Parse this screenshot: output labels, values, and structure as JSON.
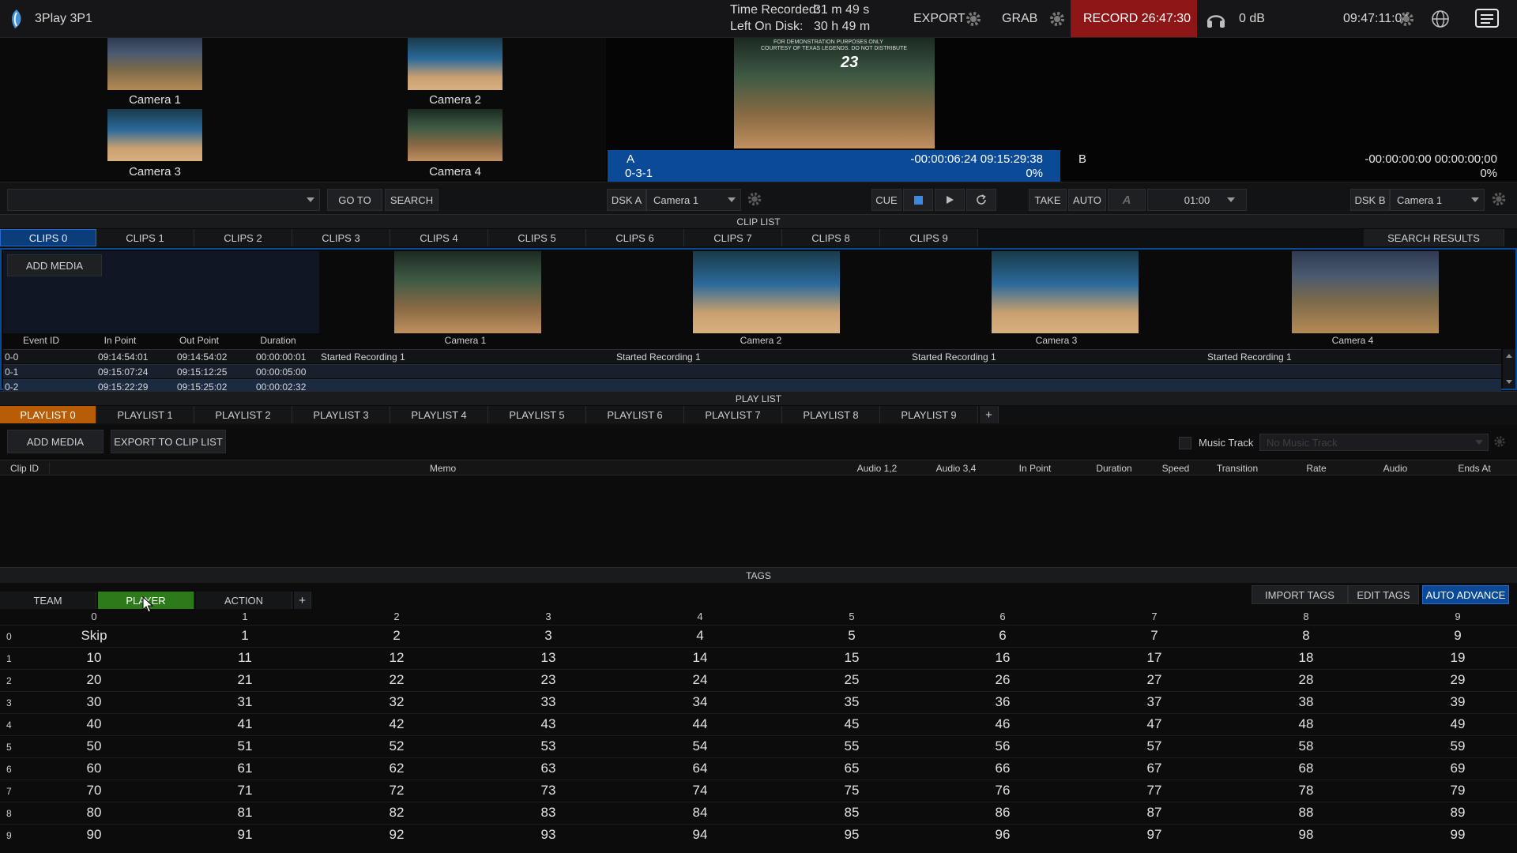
{
  "app": {
    "title": "3Play 3P1"
  },
  "status": {
    "time_recorded_label": "Time Recorded:",
    "time_recorded_value": "31 m 49 s",
    "left_on_disk_label": "Left On Disk:",
    "left_on_disk_value": "30 h 49 m",
    "export_label": "EXPORT",
    "grab_label": "GRAB",
    "record_label": "RECORD 26:47:30",
    "audio_level": "0 dB",
    "clock": "09:47:11:04"
  },
  "cameras": [
    {
      "label": "Camera 1"
    },
    {
      "label": "Camera 2"
    },
    {
      "label": "Camera 3"
    },
    {
      "label": "Camera 4"
    }
  ],
  "program": {
    "overlay_line1": "FOR DEMONSTRATION PURPOSES ONLY",
    "overlay_line2": "COURTESY OF TEXAS LEGENDS. DO NOT DISTRIBUTE",
    "jersey": "23",
    "a_channel": "A",
    "a_clip": "0-3-1",
    "a_time": "-00:00:06:24 09:15:29:38",
    "a_pct": "0%",
    "b_channel": "B",
    "b_time": "-00:00:00:00 00:00:00;00",
    "b_pct": "0%"
  },
  "controls": {
    "goto_label": "GO TO",
    "search_label": "SEARCH",
    "dska_label": "DSK A",
    "dska_source": "Camera 1",
    "cue_label": "CUE",
    "take_label": "TAKE",
    "auto_label": "AUTO",
    "duration": "01:00",
    "dskb_label": "DSK B",
    "dskb_source": "Camera 1"
  },
  "clip_list": {
    "header": "CLIP LIST",
    "tabs": [
      "CLIPS 0",
      "CLIPS 1",
      "CLIPS 2",
      "CLIPS 3",
      "CLIPS 4",
      "CLIPS 5",
      "CLIPS 6",
      "CLIPS 7",
      "CLIPS 8",
      "CLIPS 9"
    ],
    "search_results_label": "SEARCH RESULTS",
    "add_media_label": "ADD MEDIA",
    "columns": {
      "event_id": "Event ID",
      "in_point": "In Point",
      "out_point": "Out Point",
      "duration": "Duration"
    },
    "camera_columns": [
      "Camera 1",
      "Camera 2",
      "Camera 3",
      "Camera 4"
    ],
    "rows": [
      {
        "id": "0-0",
        "in": "09:14:54:01",
        "out": "09:14:54:02",
        "dur": "00:00:00:01",
        "c1": "Started Recording 1",
        "c2": "Started Recording 1",
        "c3": "Started Recording 1",
        "c4": "Started Recording 1"
      },
      {
        "id": "0-1",
        "in": "09:15:07:24",
        "out": "09:15:12:25",
        "dur": "00:00:05:00",
        "c1": "",
        "c2": "",
        "c3": "",
        "c4": ""
      },
      {
        "id": "0-2",
        "in": "09:15:22:29",
        "out": "09:15:25:02",
        "dur": "00:00:02:32",
        "c1": "",
        "c2": "",
        "c3": "",
        "c4": ""
      }
    ]
  },
  "play_list": {
    "header": "PLAY LIST",
    "tabs": [
      "PLAYLIST 0",
      "PLAYLIST 1",
      "PLAYLIST 2",
      "PLAYLIST 3",
      "PLAYLIST 4",
      "PLAYLIST 5",
      "PLAYLIST 6",
      "PLAYLIST 7",
      "PLAYLIST 8",
      "PLAYLIST 9"
    ],
    "add_tab": "+",
    "add_media_label": "ADD MEDIA",
    "export_label": "EXPORT TO CLIP LIST",
    "music_track_label": "Music Track",
    "music_track_placeholder": "No Music Track",
    "columns": [
      "Clip ID",
      "Memo",
      "Audio 1,2",
      "Audio 3,4",
      "In Point",
      "Duration",
      "Speed",
      "Transition",
      "Rate",
      "Audio",
      "Ends At"
    ]
  },
  "tags": {
    "header": "TAGS",
    "tabs": [
      "TEAM",
      "PLAYER",
      "ACTION"
    ],
    "add_tab": "+",
    "import_label": "IMPORT TAGS",
    "edit_label": "EDIT TAGS",
    "auto_advance_label": "AUTO ADVANCE",
    "col_headers": [
      "0",
      "1",
      "2",
      "3",
      "4",
      "5",
      "6",
      "7",
      "8",
      "9"
    ],
    "row_headers": [
      "0",
      "1",
      "2",
      "3",
      "4",
      "5",
      "6",
      "7",
      "8",
      "9"
    ],
    "grid": [
      [
        "Skip",
        "1",
        "2",
        "3",
        "4",
        "5",
        "6",
        "7",
        "8",
        "9"
      ],
      [
        "10",
        "11",
        "12",
        "13",
        "14",
        "15",
        "16",
        "17",
        "18",
        "19"
      ],
      [
        "20",
        "21",
        "22",
        "23",
        "24",
        "25",
        "26",
        "27",
        "28",
        "29"
      ],
      [
        "30",
        "31",
        "32",
        "33",
        "34",
        "35",
        "36",
        "37",
        "38",
        "39"
      ],
      [
        "40",
        "41",
        "42",
        "43",
        "44",
        "45",
        "46",
        "47",
        "48",
        "49"
      ],
      [
        "50",
        "51",
        "52",
        "53",
        "54",
        "55",
        "56",
        "57",
        "58",
        "59"
      ],
      [
        "60",
        "61",
        "62",
        "63",
        "64",
        "65",
        "66",
        "67",
        "68",
        "69"
      ],
      [
        "70",
        "71",
        "72",
        "73",
        "74",
        "75",
        "76",
        "77",
        "78",
        "79"
      ],
      [
        "80",
        "81",
        "82",
        "83",
        "84",
        "85",
        "86",
        "87",
        "88",
        "89"
      ],
      [
        "90",
        "91",
        "92",
        "93",
        "94",
        "95",
        "96",
        "97",
        "98",
        "99"
      ]
    ]
  },
  "colors": {
    "accent_blue": "#0a4a96",
    "record_red": "#9a1a1a",
    "playlist_orange": "#b85c06",
    "tag_green": "#2c7a1a"
  }
}
